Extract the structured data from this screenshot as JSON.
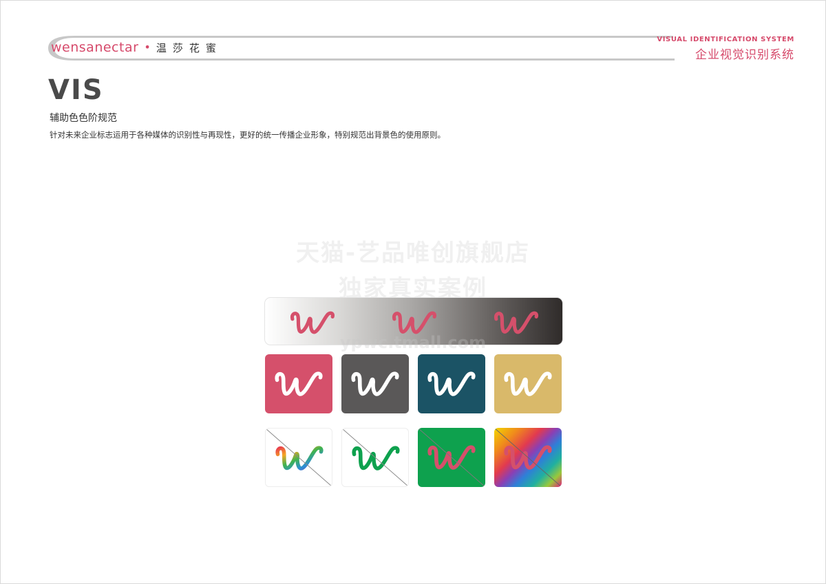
{
  "header": {
    "brand_latin": "wensanectar",
    "brand_dot": "•",
    "brand_cn": "温莎花蜜",
    "system_en": "VISUAL IDENTIFICATION SYSTEM",
    "system_cn": "企业视觉识别系统"
  },
  "page": {
    "title": "VIS",
    "subtitle": "辅助色色阶规范",
    "description": "针对未来企业标志运用于各种媒体的识别性与再现性，更好的统一传播企业形象，特别规范出背景色的使用原则。"
  },
  "watermark": {
    "line1": "天猫-艺品唯创旗舰店",
    "line2": "独家真实案例",
    "line3": "ypwc.tmall.com"
  },
  "colors": {
    "brand_pink": "#d64a6b",
    "swatch_pink": "#d5506b",
    "swatch_gray": "#5a5858",
    "swatch_teal": "#1b5365",
    "swatch_gold": "#d9b96a",
    "swatch_green": "#0ea14e"
  },
  "swatches": {
    "gradient": {
      "logo_icon": "w-script-logo-icon",
      "logo_count": 3
    },
    "allowed": [
      {
        "name": "pink",
        "bg": "#d5506b",
        "logo": "#ffffff"
      },
      {
        "name": "gray",
        "bg": "#5a5858",
        "logo": "#ffffff"
      },
      {
        "name": "teal",
        "bg": "#1b5365",
        "logo": "#ffffff"
      },
      {
        "name": "gold",
        "bg": "#d9b96a",
        "logo": "#ffffff"
      }
    ],
    "incorrect": [
      {
        "name": "rainbow-logo-on-white",
        "crossed": true
      },
      {
        "name": "green-logo-on-white",
        "crossed": true
      },
      {
        "name": "pink-logo-on-green",
        "crossed": true
      },
      {
        "name": "pink-logo-on-rainbow",
        "crossed": true
      }
    ]
  }
}
